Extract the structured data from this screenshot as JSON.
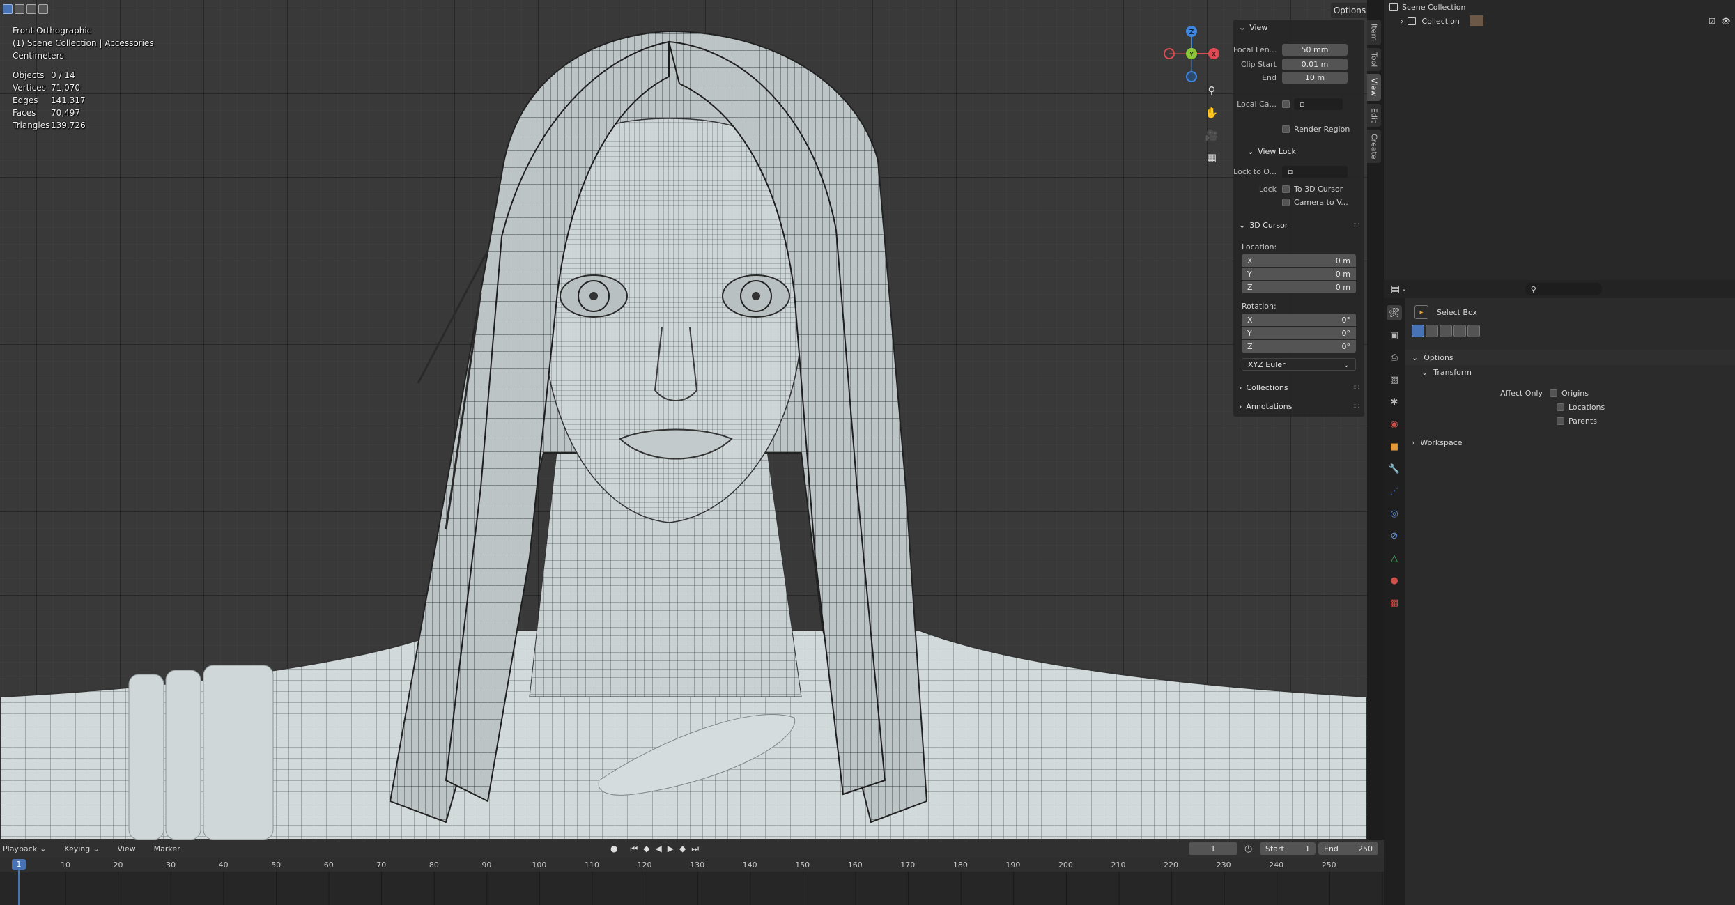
{
  "viewport": {
    "view_name": "Front Orthographic",
    "collection_info": "(1) Scene Collection | Accessories",
    "units": "Centimeters",
    "stats": [
      {
        "label": "Objects",
        "value": "0 / 14"
      },
      {
        "label": "Vertices",
        "value": "71,070"
      },
      {
        "label": "Edges",
        "value": "141,317"
      },
      {
        "label": "Faces",
        "value": "70,497"
      },
      {
        "label": "Triangles",
        "value": "139,726"
      }
    ],
    "options_label": "Options",
    "gizmo": {
      "x_label": "X",
      "y_label": "Y",
      "z_label": "Z",
      "x_color": "#e14a53",
      "y_color": "#8ac83a",
      "z_color": "#3f86e0"
    }
  },
  "npanel": {
    "view_header": "View",
    "focal_label": "Focal Len...",
    "focal_value": "50 mm",
    "clip_start_label": "Clip Start",
    "clip_start_value": "0.01 m",
    "clip_end_label": "End",
    "clip_end_value": "10 m",
    "local_camera_label": "Local Ca...",
    "render_region_label": "Render Region",
    "view_lock_header": "View Lock",
    "lock_to_object_label": "Lock to O...",
    "lock_label": "Lock",
    "to_3d_cursor_label": "To 3D Cursor",
    "camera_to_view_label": "Camera to V...",
    "cursor_header": "3D Cursor",
    "location_label": "Location:",
    "location": [
      {
        "axis": "X",
        "value": "0 m"
      },
      {
        "axis": "Y",
        "value": "0 m"
      },
      {
        "axis": "Z",
        "value": "0 m"
      }
    ],
    "rotation_label": "Rotation:",
    "rotation": [
      {
        "axis": "X",
        "value": "0°"
      },
      {
        "axis": "Y",
        "value": "0°"
      },
      {
        "axis": "Z",
        "value": "0°"
      }
    ],
    "rotation_mode": "XYZ Euler",
    "collections_label": "Collections",
    "annotations_label": "Annotations"
  },
  "vtabs": [
    "Item",
    "Tool",
    "View",
    "Edit",
    "Create"
  ],
  "outliner": {
    "scene_collection": "Scene Collection",
    "collection": "Collection"
  },
  "properties": {
    "search_placeholder": "",
    "tool_name": "Select Box",
    "options_label": "Options",
    "transform_label": "Transform",
    "affect_only_label": "Affect Only",
    "origins_label": "Origins",
    "locations_label": "Locations",
    "parents_label": "Parents",
    "workspace_label": "Workspace"
  },
  "timeline": {
    "playback_label": "Playback",
    "keying_label": "Keying",
    "view_label": "View",
    "marker_label": "Marker",
    "current_frame": "1",
    "start_label": "Start",
    "start_value": "1",
    "end_label": "End",
    "end_value": "250",
    "ruler_marks": [
      "1",
      "10",
      "20",
      "30",
      "40",
      "50",
      "60",
      "70",
      "80",
      "90",
      "100",
      "110",
      "120",
      "130",
      "140",
      "150",
      "160",
      "170",
      "180",
      "190",
      "200",
      "210",
      "220",
      "230",
      "240",
      "250"
    ]
  }
}
